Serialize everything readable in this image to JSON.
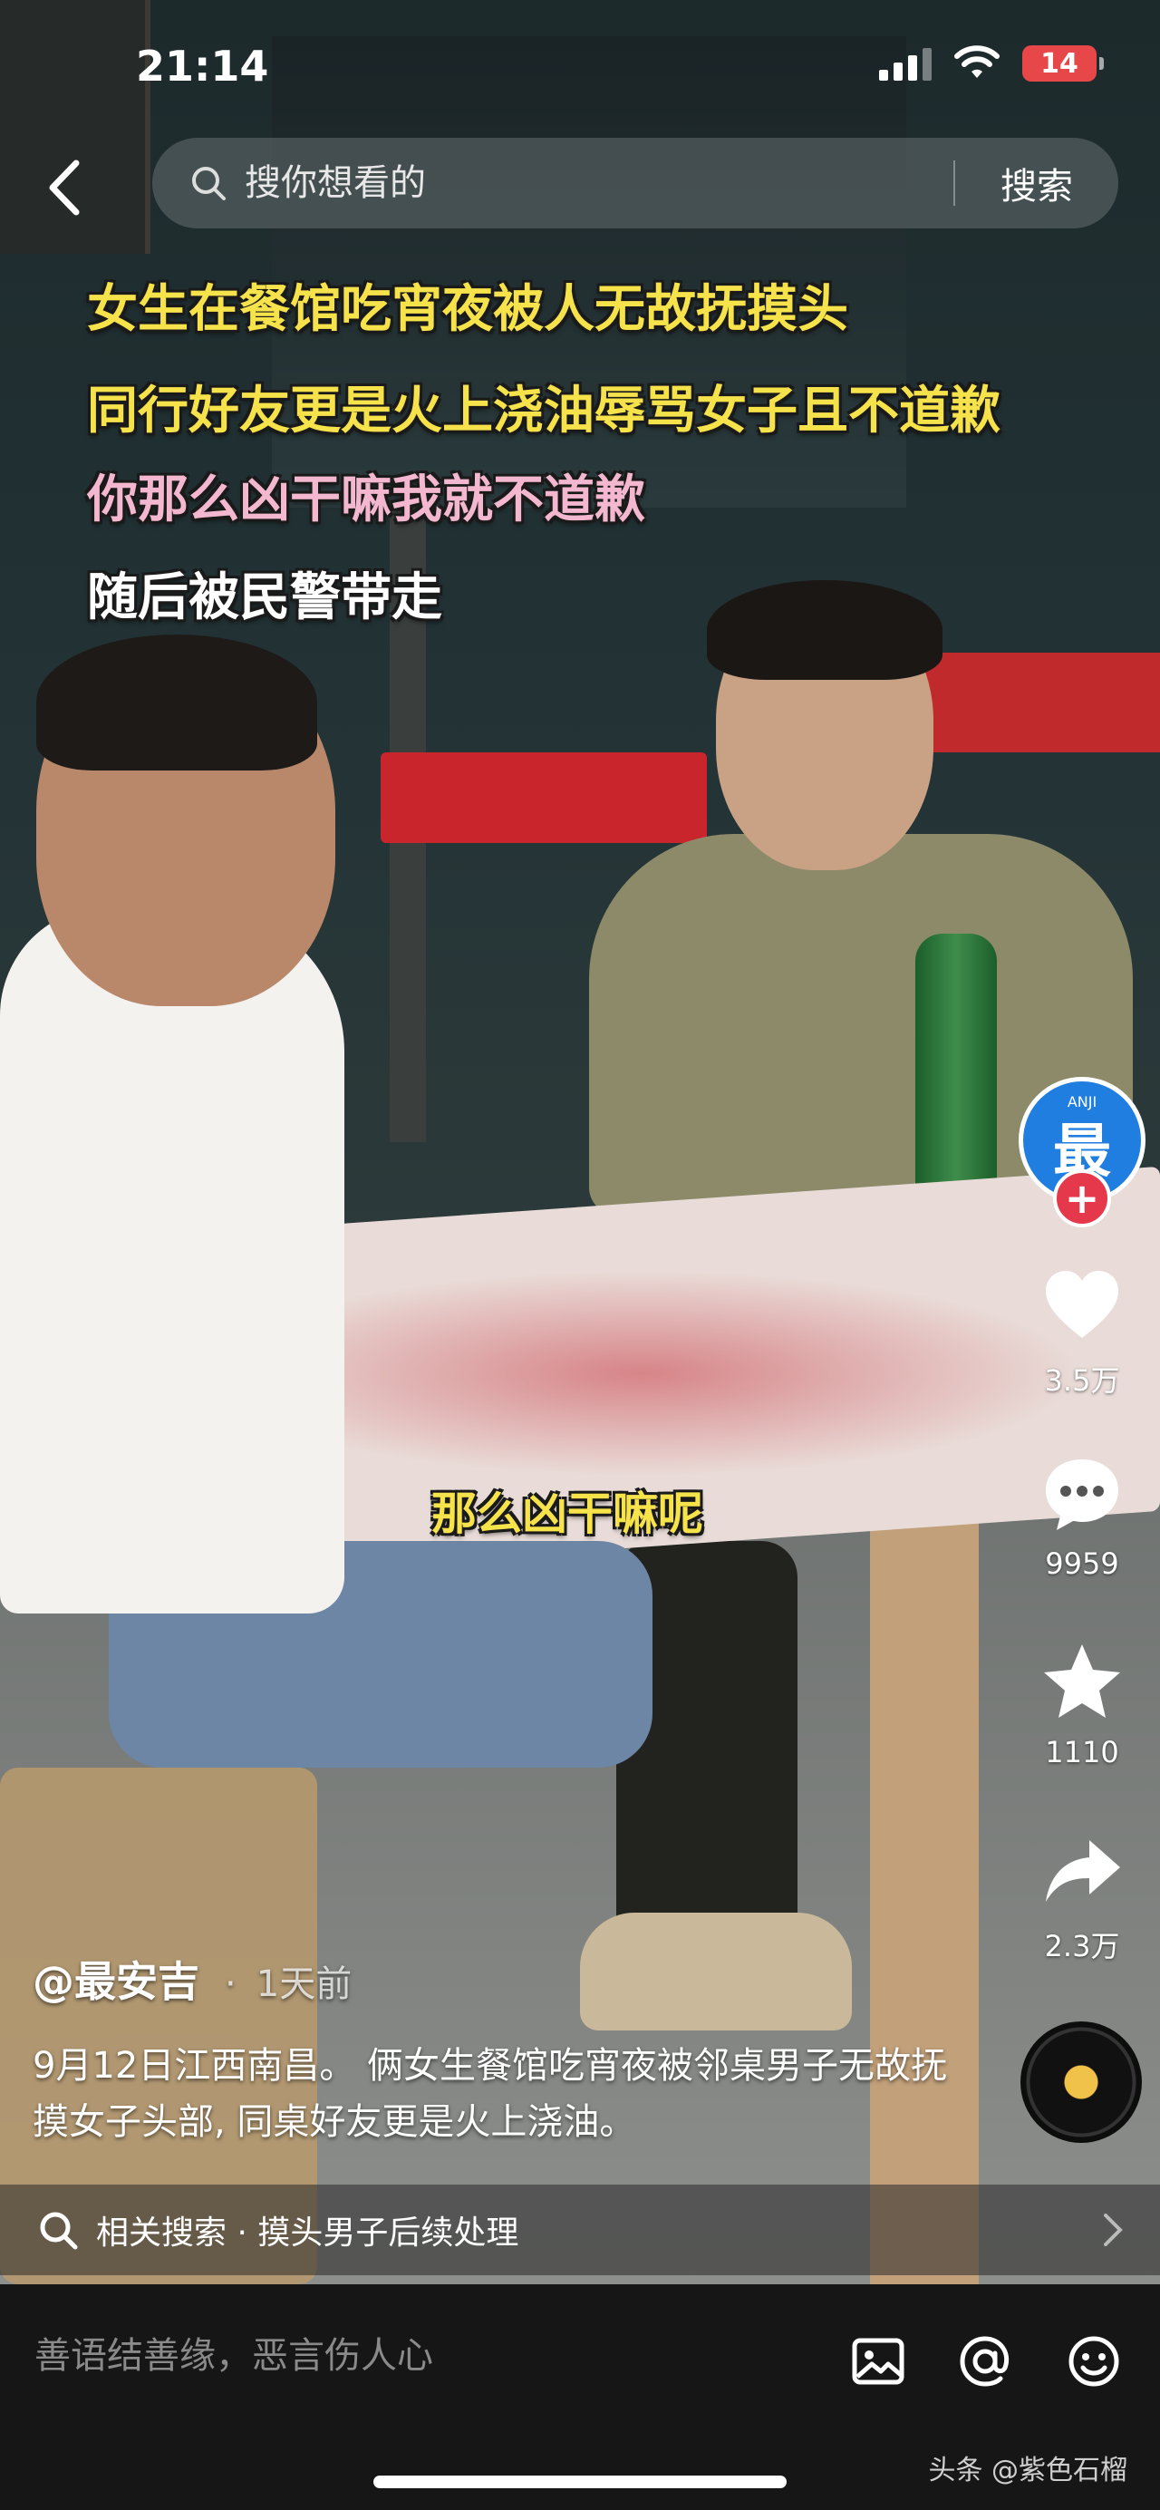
{
  "status_bar": {
    "time": "21:14",
    "battery": "14"
  },
  "search": {
    "placeholder": "搜你想看的",
    "button": "搜索"
  },
  "captions": {
    "line1": "女生在餐馆吃宵夜被人无故抚摸头",
    "line2": "同行好友更是火上浇油辱骂女子且不道歉",
    "line3": "你那么凶干嘛我就不道歉",
    "line4": "随后被民警带走",
    "subtitle": "那么凶干嘛呢"
  },
  "author_avatar": {
    "small": "ANJI",
    "big": "最"
  },
  "actions": {
    "likes": "3.5万",
    "comments": "9959",
    "favorites": "1110",
    "shares": "2.3万"
  },
  "post": {
    "author": "@最安吉",
    "separator": "·",
    "time": "1天前",
    "description": "9月12日江西南昌。 俩女生餐馆吃宵夜被邻桌男子无故抚摸女子头部, 同桌好友更是火上浇油。"
  },
  "related": {
    "text": "相关搜索 · 摸头男子后续处理"
  },
  "comment": {
    "placeholder": "善语结善缘，恶言伤人心"
  },
  "watermark": "头条 @紫色石榴",
  "icons": [
    "back-icon",
    "search-icon",
    "heart-icon",
    "comment-icon",
    "star-icon",
    "share-icon",
    "image-icon",
    "at-icon",
    "emoji-icon",
    "chevron-right-icon"
  ]
}
